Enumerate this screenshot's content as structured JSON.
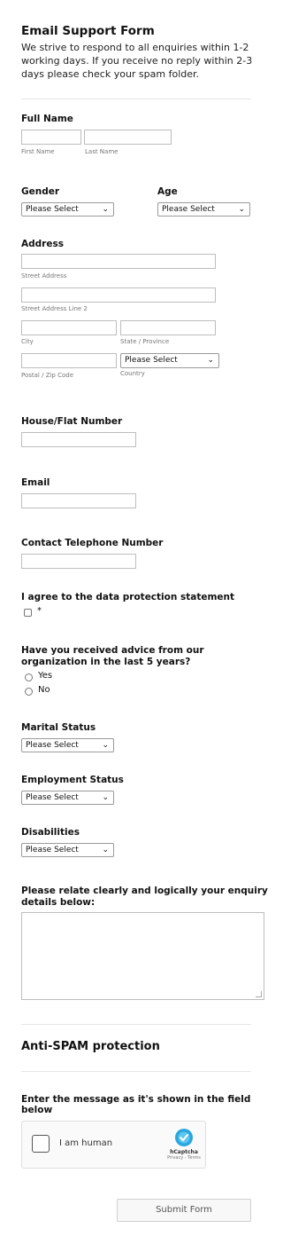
{
  "form": {
    "title": "Email Support Form",
    "intro": "We strive to respond to all enquiries within 1-2 working days. If you receive no reply within 2-3 days please check your spam folder."
  },
  "full_name": {
    "label": "Full Name",
    "first_sub": "First Name",
    "last_sub": "Last Name"
  },
  "gender": {
    "label": "Gender",
    "value": "Please Select"
  },
  "age": {
    "label": "Age",
    "value": "Please Select"
  },
  "address": {
    "label": "Address",
    "street_sub": "Street Address",
    "street2_sub": "Street Address Line 2",
    "city_sub": "City",
    "state_sub": "State / Province",
    "postal_sub": "Postal / Zip Code",
    "country_sub": "Country",
    "country_value": "Please Select"
  },
  "house": {
    "label": "House/Flat Number"
  },
  "email": {
    "label": "Email"
  },
  "phone": {
    "label": "Contact Telephone Number"
  },
  "agree": {
    "label": "I agree to the data protection statement",
    "required_mark": "*"
  },
  "advice": {
    "label_line1": "Have you received advice from our",
    "label_line2": "organization in the last 5 years?",
    "options": [
      "Yes",
      "No"
    ]
  },
  "marital": {
    "label": "Marital Status",
    "value": "Please Select"
  },
  "employment": {
    "label": "Employment Status",
    "value": "Please Select"
  },
  "disabilities": {
    "label": "Disabilities",
    "value": "Please Select"
  },
  "enquiry": {
    "label_line1": "Please relate clearly and logically your enquiry",
    "label_line2": "details below:"
  },
  "antispam": {
    "title": "Anti-SPAM protection",
    "instruction_line1": "Enter the message as it's shown in the field",
    "instruction_line2": "below",
    "captcha_label": "I am human",
    "captcha_brand": "hCaptcha",
    "captcha_links": "Privacy - Terms"
  },
  "submit": {
    "label": "Submit Form"
  },
  "icons": {
    "select_chevron": "chevron-down-icon",
    "captcha_logo": "hcaptcha-logo-icon"
  },
  "colors": {
    "border": "#bdbdbd",
    "text": "#111111",
    "muted": "#777777",
    "hcaptcha": "#2aa7df"
  }
}
